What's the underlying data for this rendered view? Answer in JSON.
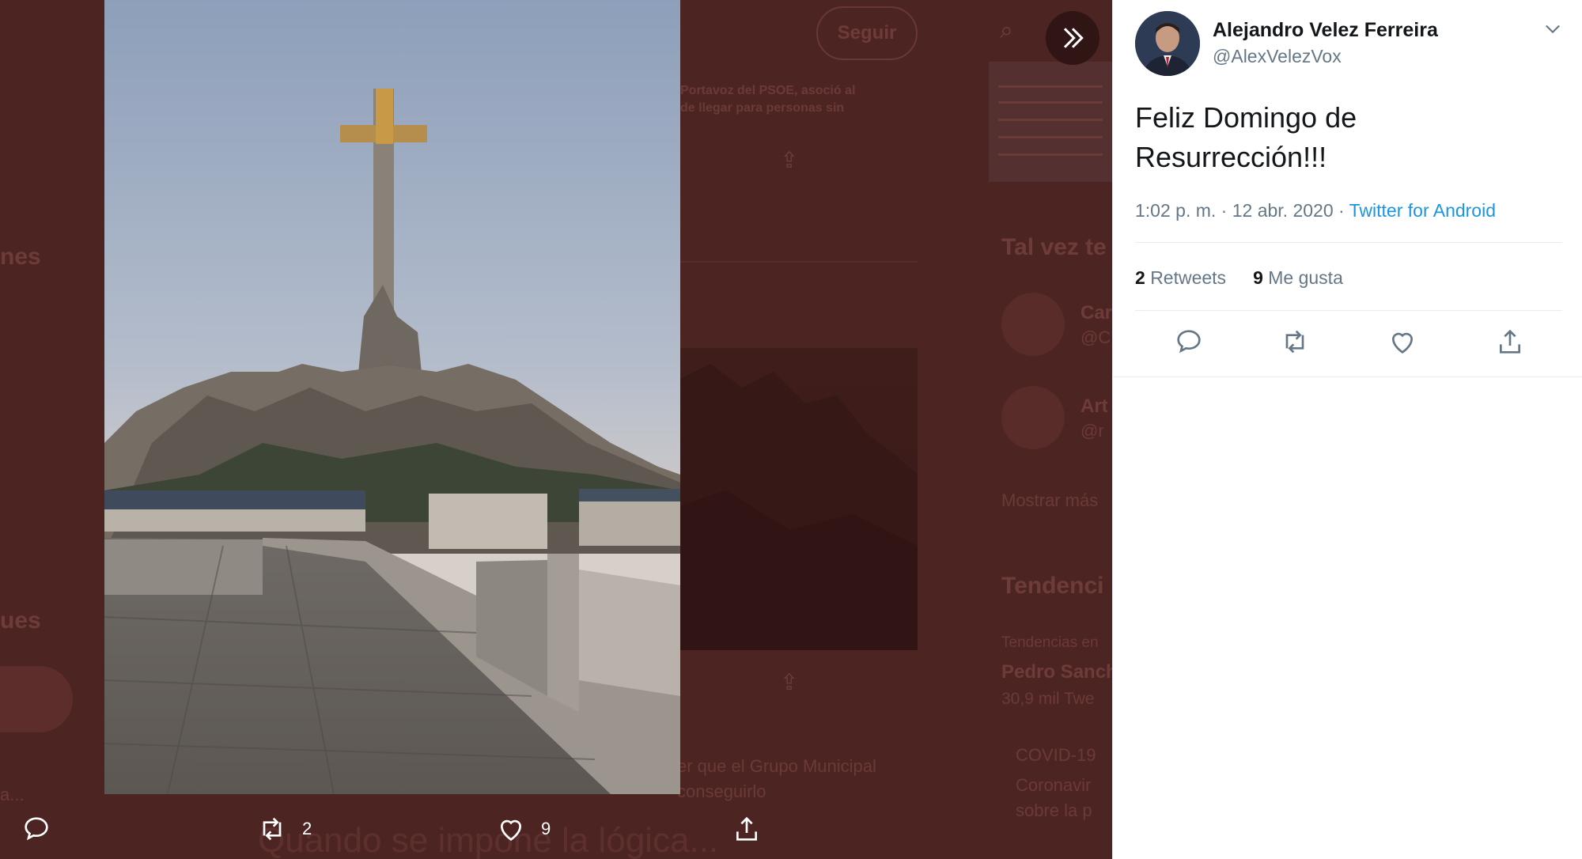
{
  "background": {
    "follow_label": "Seguir",
    "sidebar_fragments": [
      "nes",
      "ues",
      "a..."
    ],
    "tweet_snippet_top": [
      "Portavoz del PSOE, asoció al",
      "de llegar para personas sin"
    ],
    "tweet_snippet_bottom": [
      "er que el Grupo Municipal",
      "conseguirlo"
    ],
    "headline_behind": "Quando se impone la lógica...",
    "who_to_follow_title": "Tal vez te",
    "suggest_1_short": "Car",
    "suggest_1_handle": "@C",
    "suggest_2_short": "Art",
    "suggest_2_handle": "@r",
    "show_more": "Mostrar más",
    "trends_title": "Tendenci",
    "trend_context": "Tendencias en",
    "trend_name": "Pedro Sanch",
    "trend_count": "30,9 mil Twe",
    "trend_2": "COVID-19",
    "trend_2_line1": "Coronavir",
    "trend_2_line2": "sobre la p"
  },
  "media_actions": {
    "retweets": "2",
    "likes": "9"
  },
  "tweet": {
    "author_name": "Alejandro Velez Ferreira",
    "author_handle": "@AlexVelezVox",
    "text_line1": "Feliz Domingo de",
    "text_line2": "Resurrección!!!",
    "time_date": "1:02 p. m. · 12 abr. 2020 · ",
    "source": "Twitter for Android",
    "retweet_count": "2",
    "retweet_label": "Retweets",
    "like_count": "9",
    "like_label": "Me gusta"
  },
  "icons": {
    "reply": "reply-icon",
    "retweet": "retweet-icon",
    "like": "heart-icon",
    "share": "share-icon",
    "expand": "double-chevron-right-icon",
    "more": "chevron-down-icon"
  },
  "colors": {
    "overlay": "#4c2523",
    "link": "#1b95e0",
    "text_primary": "#14171a",
    "text_secondary": "#657786"
  }
}
